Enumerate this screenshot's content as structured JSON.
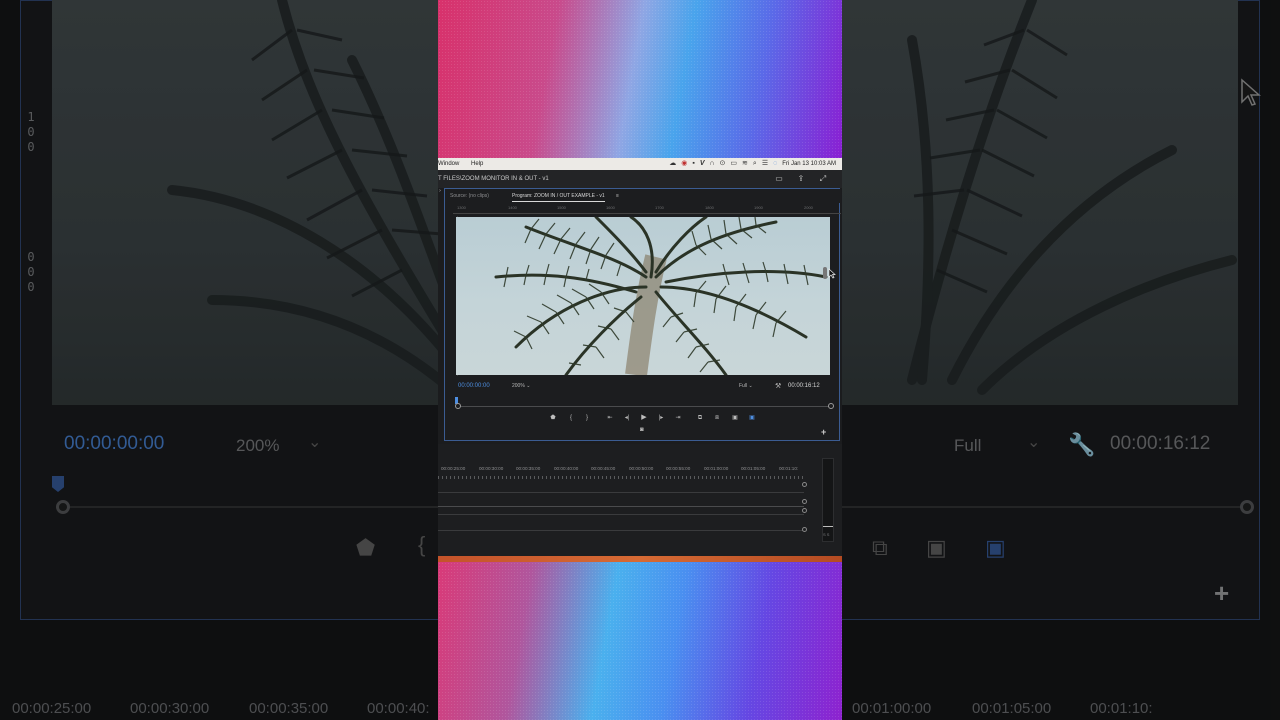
{
  "colors": {
    "accent_blue": "#4e8ee0",
    "panel_border": "#3b5c92",
    "gradient_pink": "#d8316b",
    "gradient_cyan": "#49a4ec",
    "gradient_purple": "#8a1fd3"
  },
  "menubar": {
    "items": [
      "Window",
      "Help"
    ],
    "status_icons": [
      "cloud-icon",
      "record-icon",
      "app-icon",
      "v-icon",
      "headphones-icon",
      "circle-icon",
      "battery-icon",
      "wifi-icon",
      "search-icon",
      "control-center-icon",
      "siri-icon"
    ],
    "clock": "Fri Jan 13  10:03 AM"
  },
  "window": {
    "path": "T FILES\\ZOOM MONITOR IN & OUT - v1"
  },
  "monitor": {
    "tabs": {
      "source": "Source: (no clips)",
      "program": "Program: ZOOM IN / OUT EXAMPLE - v1",
      "program_menu": "≡"
    },
    "ruler_labels": [
      "1300",
      "1400",
      "1500",
      "1600",
      "1700",
      "1800",
      "1900",
      "2000"
    ],
    "timecode_current": "00:00:00:00",
    "zoom_level": "200%",
    "quality": "Full",
    "timecode_duration": "00:00:16:12",
    "playhead_progress": 0
  },
  "timeline": {
    "ruler_labels": [
      "00:00:25:00",
      "00:00:30:00",
      "00:00:35:00",
      "00:00:40:00",
      "00:00:45:00",
      "00:00:50:00",
      "00:00:55:00",
      "00:01:00:00",
      "00:01:05:00",
      "00:01:10:"
    ],
    "meter_label": "S S"
  },
  "background": {
    "timecode_current": "00:00:00:00",
    "zoom_level": "200%",
    "quality": "Full",
    "timecode_duration": "00:00:16:12",
    "ruler_digits": [
      "1",
      "0",
      "0",
      "0",
      "0",
      "0"
    ],
    "timeline_labels": [
      "00:00:25:00",
      "00:00:30:00",
      "00:00:35:00",
      "00:00:40:",
      "00:01:00:00",
      "00:01:05:00",
      "00:01:10:"
    ]
  }
}
